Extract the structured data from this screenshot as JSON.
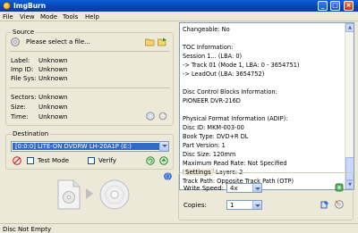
{
  "window": {
    "title": "ImgBurn"
  },
  "menu": [
    "File",
    "View",
    "Mode",
    "Tools",
    "Help"
  ],
  "source": {
    "group_label": "Source",
    "placeholder": "Please select a file...",
    "info": [
      {
        "label": "Label:",
        "value": "Unknown"
      },
      {
        "label": "Imp ID:",
        "value": "Unknown"
      },
      {
        "label": "File Sys:",
        "value": "Unknown"
      },
      {
        "label": "Sectors:",
        "value": "Unknown"
      },
      {
        "label": "Size:",
        "value": "Unknown"
      },
      {
        "label": "Time:",
        "value": "Unknown"
      }
    ]
  },
  "destination": {
    "group_label": "Destination",
    "selected_drive": "[0:0:0] LITE-ON DVDRW LH-20A1P (E:)",
    "test_mode_label": "Test Mode",
    "verify_label": "Verify",
    "test_mode_checked": false,
    "verify_checked": false
  },
  "log": [
    "Changeable: No",
    "",
    "TOC Information:",
    "Session 1... (LBA: 0)",
    "-> Track 01  (Mode 1, LBA: 0 - 3654751)",
    "-> LeadOut  (LBA: 3654752)",
    "",
    "Disc Control Blocks Information:",
    "PIONEER DVR-216D",
    "",
    "Physical Format Information (ADIP):",
    "Disc ID: MKM-003-00",
    "Book Type: DVD+R DL",
    "Part Version: 1",
    "Disc Size: 120mm",
    "Maximum Read Rate: Not Specified",
    "Number of Layers: 2",
    "Track Path: Opposite Track Path (OTP)"
  ],
  "settings": {
    "group_label": "Settings",
    "write_speed_label": "Write Speed:",
    "write_speed_value": "4x",
    "copies_label": "Copies:",
    "copies_value": "1"
  },
  "status": {
    "text": "Disc Not Empty"
  },
  "colors": {
    "title_bar": "#0a4fc8",
    "selection": "#316ac5",
    "window_bg": "#ece9d8"
  }
}
